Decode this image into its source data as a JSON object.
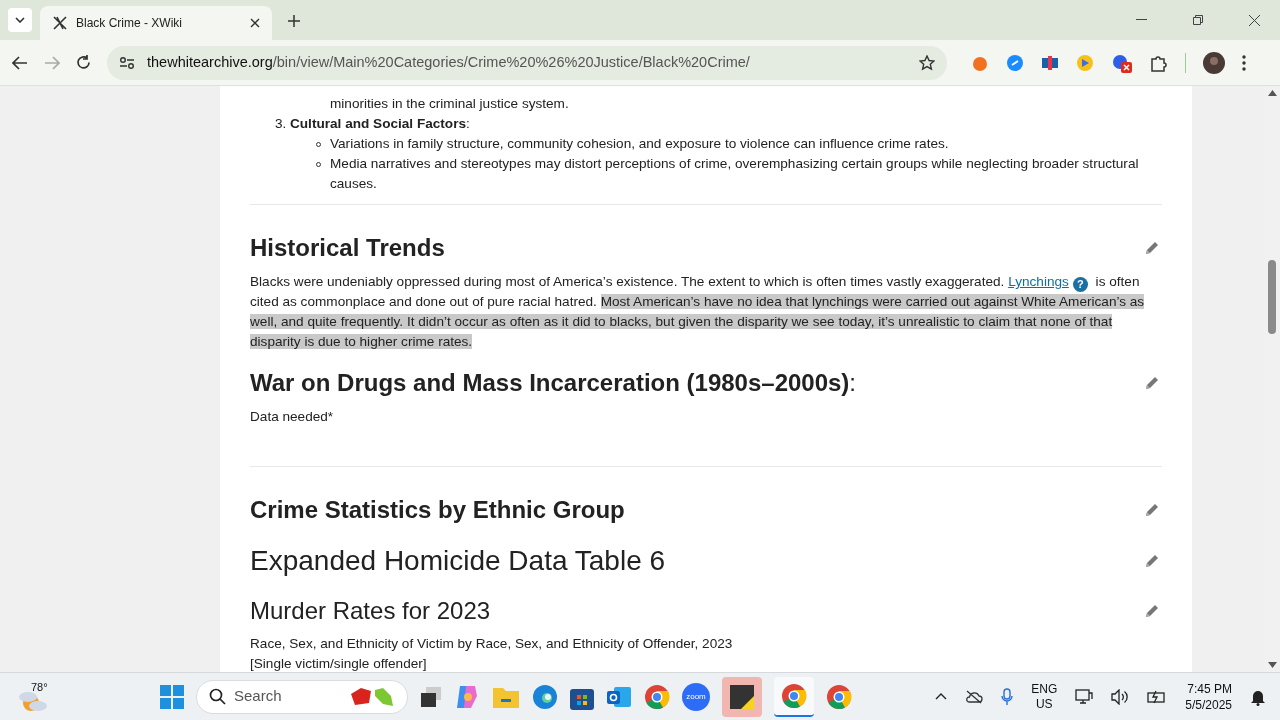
{
  "browser": {
    "tab": {
      "title": "Black Crime - XWiki",
      "selected": true
    },
    "url": {
      "host": "thewhitearchive.org",
      "path": "/bin/view/Main%20Categories/Crime%20%26%20Justice/Black%20Crime/"
    }
  },
  "article": {
    "list_tail": "minorities in the criminal justice system.",
    "numbered_item": {
      "number": "3.",
      "title": "**Cultural and Social Factors**:",
      "bullets": [
        "Variations in family structure, community cohesion, and exposure to violence can influence crime rates.",
        "Media narratives and stereotypes may distort perceptions of crime, overemphasizing certain groups while neglecting broader structural causes."
      ]
    },
    "sections": [
      {
        "kind": "h2",
        "title": "Historical Trends",
        "divider": true,
        "body": [
          {
            "kind": "text",
            "text": "Blacks were undeniably oppressed during most of America’s existence. The extent to which is often times vastly exaggerated. ",
            "selected": false
          },
          {
            "kind": "link",
            "text": "Lynchings",
            "selected": false
          },
          {
            "kind": "help",
            "text": "?",
            "selected": false
          },
          {
            "kind": "text",
            "text": " is often cited as commonplace and done out of pure racial hatred. ",
            "selected": false
          },
          {
            "kind": "text",
            "text": "Most American’s have no idea that lynchings were carried out against White American’s as well, and quite frequently. It didn’t occur as often as it did to blacks, but given the disparity we see today, it’s unrealistic to claim that none of that disparity is due to higher crime rates.",
            "selected": true
          }
        ]
      },
      {
        "kind": "h2",
        "title": "War on Drugs and Mass Incarceration (1980s–2000s)",
        "suffix": ":",
        "divider": false,
        "body": [
          {
            "kind": "text",
            "text": "Data needed*",
            "selected": false
          }
        ]
      },
      {
        "kind": "h2",
        "title": "Crime Statistics by Ethnic Group",
        "divider": true
      },
      {
        "kind": "h1",
        "title": "Expanded Homicide Data Table 6",
        "divider": false
      },
      {
        "kind": "h3",
        "title": "Murder Rates for 2023",
        "divider": false,
        "body": [
          {
            "kind": "text",
            "text": "Race, Sex, and Ethnicity of Victim by Race, Sex, and Ethnicity of Offender, 2023",
            "selected": false
          },
          {
            "kind": "break",
            "text": "[Single victim/single offender]",
            "selected": false
          }
        ]
      }
    ]
  },
  "taskbar": {
    "weather": "78°",
    "search_placeholder": "Search",
    "zoom_label": "zoom",
    "language": "ENG",
    "region": "US",
    "time": "7:45 PM",
    "date": "5/5/2025"
  }
}
